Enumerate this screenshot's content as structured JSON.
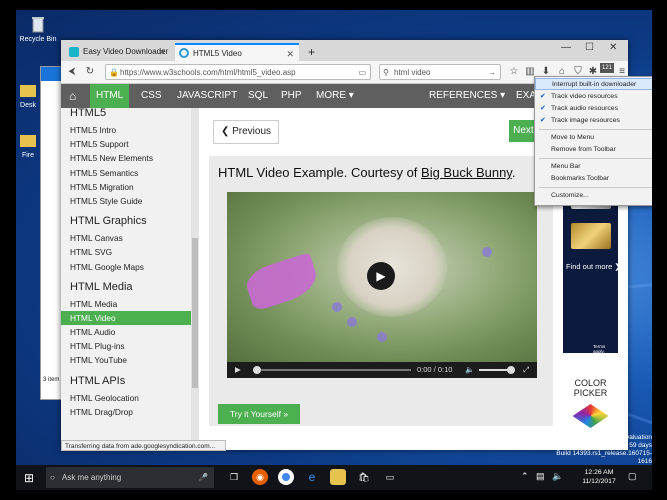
{
  "desktop": {
    "icons": [
      "Recycle Bin",
      "Desk",
      "Fire"
    ]
  },
  "tabs": [
    {
      "label": "Easy Video Downloader - Ad"
    },
    {
      "label": "HTML5 Video"
    }
  ],
  "address": {
    "url": "https://www.w3schools.com/html/html5_video.asp",
    "search": "html video"
  },
  "w3nav": {
    "home": "⌂",
    "items": [
      "HTML",
      "CSS",
      "JAVASCRIPT",
      "SQL",
      "PHP",
      "MORE ▾"
    ],
    "references": "REFERENCES ▾",
    "examples": "EXAMPL"
  },
  "sidebar": {
    "sections": [
      {
        "heading": "HTML5",
        "links": [
          "HTML5 Intro",
          "HTML5 Support",
          "HTML5 New Elements",
          "HTML5 Semantics",
          "HTML5 Migration",
          "HTML5 Style Guide"
        ]
      },
      {
        "heading": "HTML Graphics",
        "links": [
          "HTML Canvas",
          "HTML SVG",
          "HTML Google Maps"
        ]
      },
      {
        "heading": "HTML Media",
        "links": [
          "HTML Media",
          "HTML Video",
          "HTML Audio",
          "HTML Plug-ins",
          "HTML YouTube"
        ]
      },
      {
        "heading": "HTML APIs",
        "links": [
          "HTML Geolocation",
          "HTML Drag/Drop"
        ]
      }
    ],
    "active": "HTML Video"
  },
  "main": {
    "prev": "❮ Previous",
    "next": "Next ❯",
    "example_title_prefix": "HTML Video Example. Courtesy of ",
    "example_title_link": "Big Buck Bunny",
    "example_title_suffix": ".",
    "video_time": "0:00 / 0:10",
    "try_it": "Try it Yourself »"
  },
  "ad": {
    "find_more": "Find out more ❯",
    "terms": "Terms apply."
  },
  "picker": {
    "line1": "COLOR",
    "line2": "PICKER"
  },
  "status_bar": "Transferring data from ade.googlesyndication.com...",
  "explorer_status": "3 item",
  "menu": {
    "items": [
      {
        "label": "Interrupt built-in downloader",
        "checked": false,
        "highlight": true
      },
      {
        "label": "Track video resources",
        "checked": true
      },
      {
        "label": "Track audio resources",
        "checked": true
      },
      {
        "label": "Track image resources",
        "checked": true
      },
      {
        "label": "Move to Menu",
        "checked": false
      },
      {
        "label": "Remove from Toolbar",
        "checked": false
      },
      {
        "label": "Menu Bar",
        "checked": false
      },
      {
        "label": "Bookmarks Toolbar",
        "checked": false
      },
      {
        "label": "Customize...",
        "checked": false
      }
    ]
  },
  "toolbar_badge": "121",
  "taskbar": {
    "search_placeholder": "Ask me anything",
    "time": "12:26 AM",
    "date": "11/12/2017"
  },
  "watermark": {
    "line1": "Windows 10 Enterprise Evaluation",
    "line2": "Windows License valid for 59 days",
    "line3": "Build 14393.rs1_release.160715-1616"
  },
  "colors": {
    "w3_green": "#4caf50",
    "w3_nav": "#5f5f5f",
    "firefox_accent": "#0a84ff"
  }
}
